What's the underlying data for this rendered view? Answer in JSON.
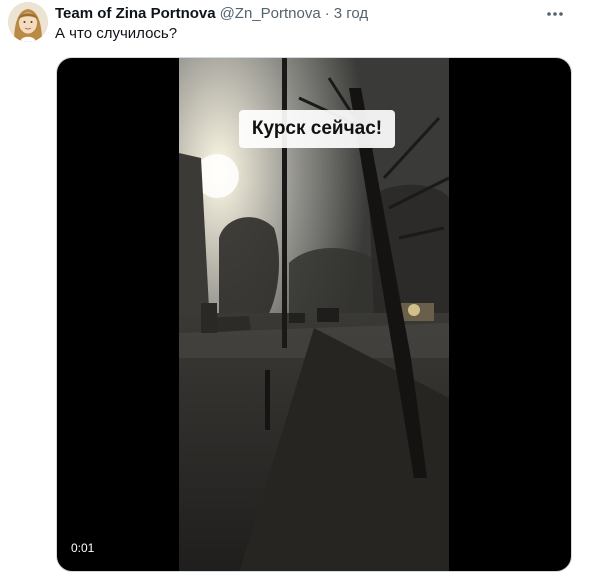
{
  "tweet": {
    "author_name": "Team of Zina Portnova",
    "author_handle": "@Zn_Portnova",
    "separator": "·",
    "timestamp": "3 год",
    "text": "А что случилось?"
  },
  "media": {
    "caption": "Курск сейчас!",
    "duration": "0:01"
  },
  "icons": {
    "more": "more-horizontal-icon",
    "avatar": "avatar-portrait"
  },
  "colors": {
    "name": "#0f1419",
    "secondary": "#536471",
    "media_border": "#cfd9de",
    "media_background": "#000000"
  }
}
